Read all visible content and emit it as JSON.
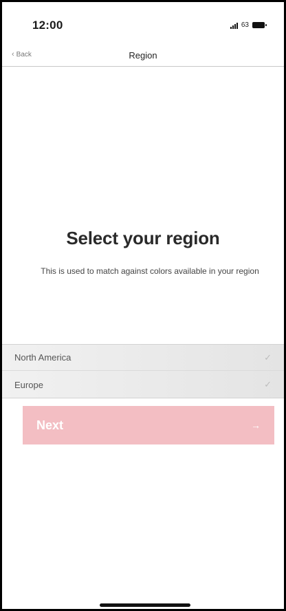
{
  "status_bar": {
    "time": "12:00",
    "battery_percent": "63"
  },
  "nav": {
    "back_label": "Back",
    "title": "Region"
  },
  "hero": {
    "title": "Select your region",
    "description": "This is used to match against colors available in your region"
  },
  "regions": [
    {
      "label": "North America",
      "icon": "check-icon"
    },
    {
      "label": "Europe",
      "icon": "check-icon"
    }
  ],
  "next_button": {
    "label": "Next",
    "icon": "arrow-right-icon",
    "color": "#f3bec3"
  }
}
